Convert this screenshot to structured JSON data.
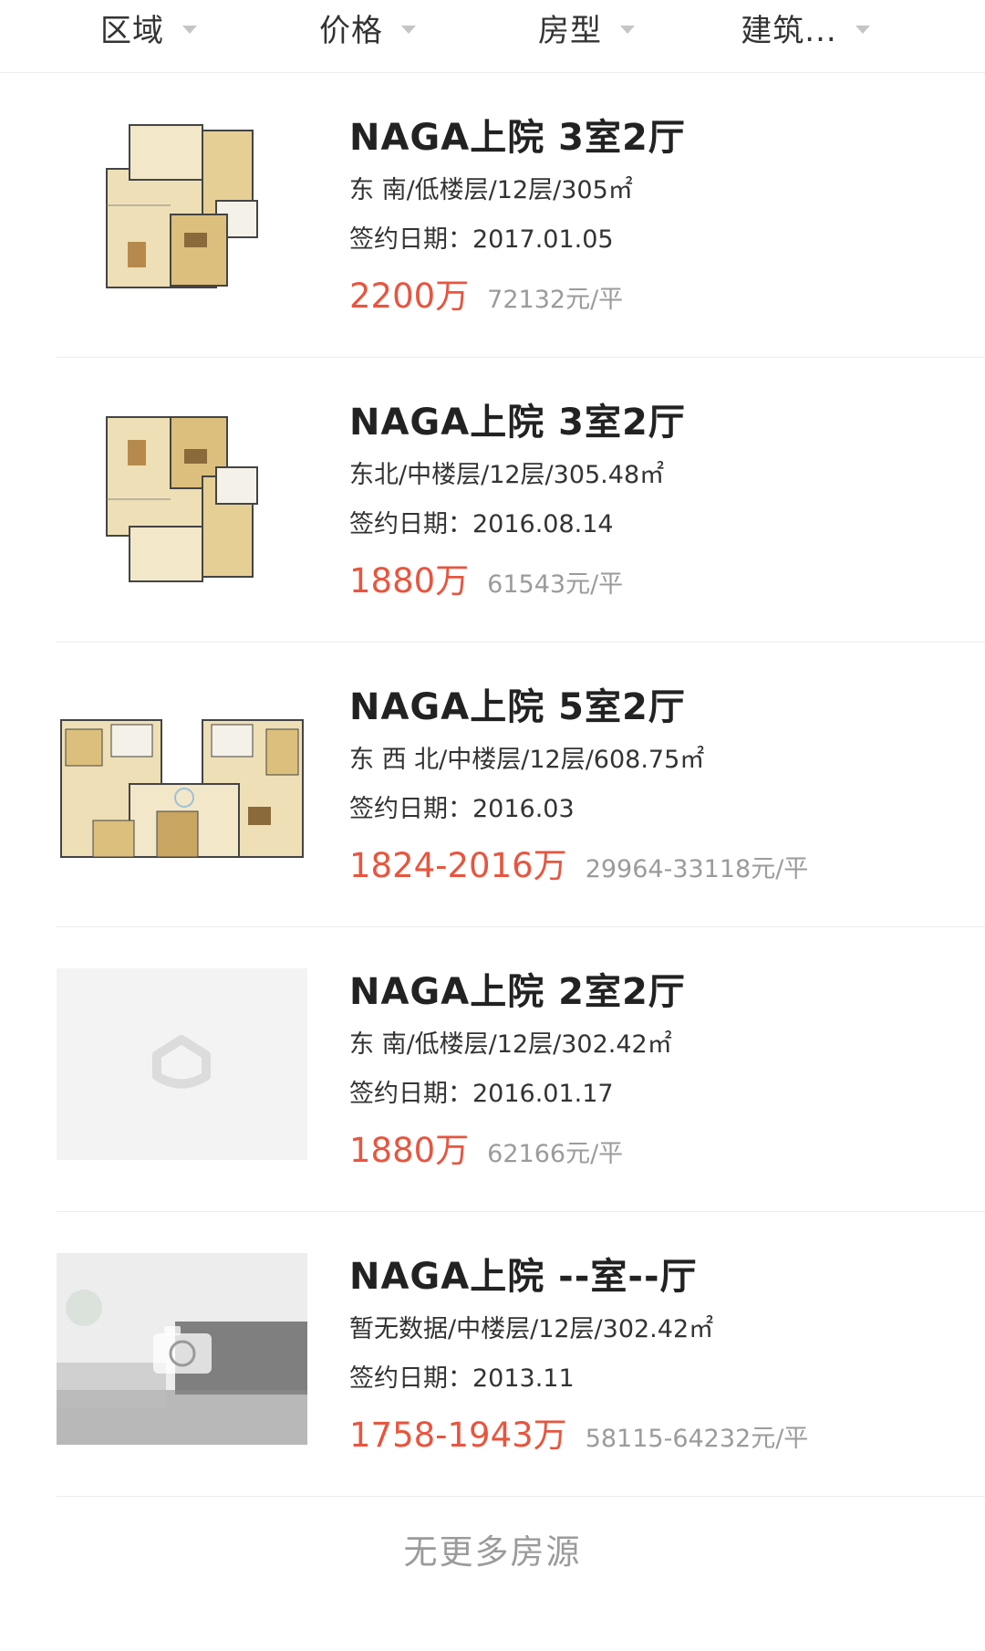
{
  "filters": [
    {
      "label": "区域"
    },
    {
      "label": "价格"
    },
    {
      "label": "房型"
    },
    {
      "label": "建筑..."
    }
  ],
  "listings": [
    {
      "title": "NAGA上院 3室2厅",
      "meta": "东 南/低楼层/12层/305㎡",
      "date": "签约日期：2017.01.05",
      "price": "2200万",
      "unit_price": "72132元/平",
      "thumb": "floorplan"
    },
    {
      "title": "NAGA上院 3室2厅",
      "meta": "东北/中楼层/12层/305.48㎡",
      "date": "签约日期：2016.08.14",
      "price": "1880万",
      "unit_price": "61543元/平",
      "thumb": "floorplan"
    },
    {
      "title": "NAGA上院 5室2厅",
      "meta": "东 西 北/中楼层/12层/608.75㎡",
      "date": "签约日期：2016.03",
      "price": "1824-2016万",
      "unit_price": "29964-33118元/平",
      "thumb": "floorplan-wide"
    },
    {
      "title": "NAGA上院 2室2厅",
      "meta": "东 南/低楼层/12层/302.42㎡",
      "date": "签约日期：2016.01.17",
      "price": "1880万",
      "unit_price": "62166元/平",
      "thumb": "placeholder"
    },
    {
      "title": "NAGA上院 --室--厅",
      "meta": "暂无数据/中楼层/12层/302.42㎡",
      "date": "签约日期：2013.11",
      "price": "1758-1943万",
      "unit_price": "58115-64232元/平",
      "thumb": "photo-placeholder"
    }
  ],
  "footer": "无更多房源",
  "colors": {
    "price": "#e8553f",
    "muted": "#9b9b9b",
    "divider": "#ececec",
    "floorplan_room": "#e9d7a8",
    "floorplan_wall": "#3a3a3a"
  }
}
